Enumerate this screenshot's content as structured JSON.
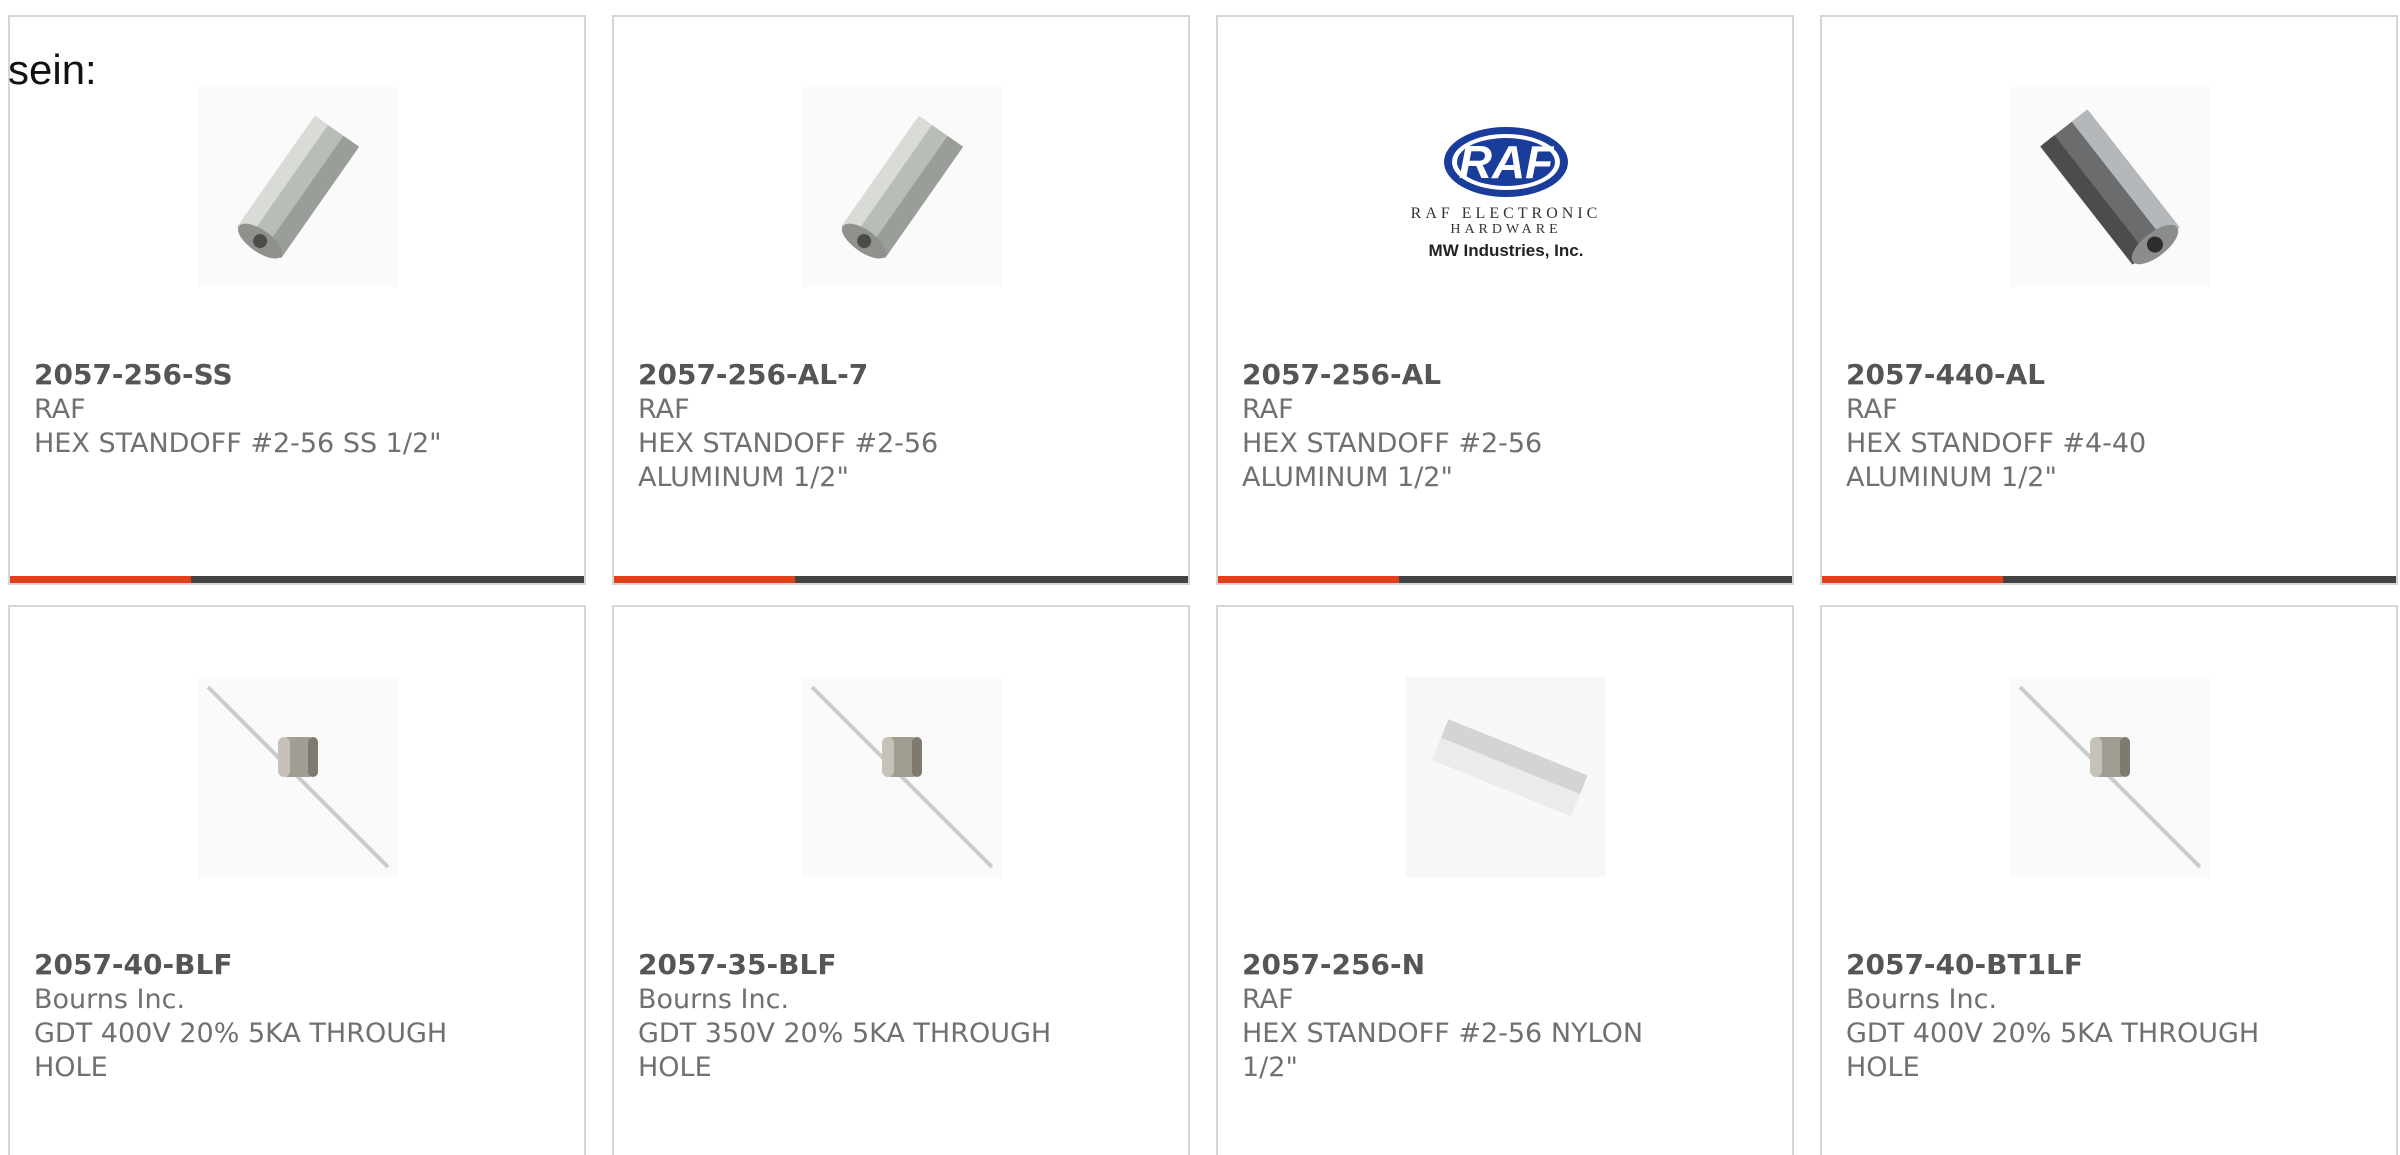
{
  "intro_text": "sein:",
  "colors": {
    "progress_fill": "#e0401a",
    "progress_track": "#444444",
    "card_border": "#d6d6d6",
    "text": "#707070"
  },
  "products": [
    {
      "part_number": "2057-256-SS",
      "manufacturer": "RAF",
      "description": "HEX STANDOFF #2-56 SS 1/2\"",
      "image": "hex-standoff-steel-icon",
      "progress": 0.315
    },
    {
      "part_number": "2057-256-AL-7",
      "manufacturer": "RAF",
      "description": "HEX STANDOFF #2-56 ALUMINUM 1/2\"",
      "image": "hex-standoff-steel-icon",
      "progress": 0.315
    },
    {
      "part_number": "2057-256-AL",
      "manufacturer": "RAF",
      "description": "HEX STANDOFF #2-56 ALUMINUM 1/2\"",
      "image": "raf-logo",
      "logo_text": "RAF",
      "logo_line1": "RAF ELECTRONIC",
      "logo_line2": "HARDWARE",
      "logo_line3": "MW Industries, Inc.",
      "progress": 0.315
    },
    {
      "part_number": "2057-440-AL",
      "manufacturer": "RAF",
      "description": "HEX STANDOFF #4-40 ALUMINUM 1/2\"",
      "image": "hex-standoff-dark-icon",
      "progress": 0.315
    },
    {
      "part_number": "2057-40-BLF",
      "manufacturer": "Bourns Inc.",
      "description": "GDT 400V 20% 5KA THROUGH HOLE",
      "image": "gdt-axial-icon"
    },
    {
      "part_number": "2057-35-BLF",
      "manufacturer": "Bourns Inc.",
      "description": "GDT 350V 20% 5KA THROUGH HOLE",
      "image": "gdt-axial-icon"
    },
    {
      "part_number": "2057-256-N",
      "manufacturer": "RAF",
      "description": "HEX STANDOFF #2-56 NYLON 1/2\"",
      "image": "nylon-standoff-icon"
    },
    {
      "part_number": "2057-40-BT1LF",
      "manufacturer": "Bourns Inc.",
      "description": "GDT 400V 20% 5KA THROUGH HOLE",
      "image": "gdt-axial-icon"
    }
  ]
}
